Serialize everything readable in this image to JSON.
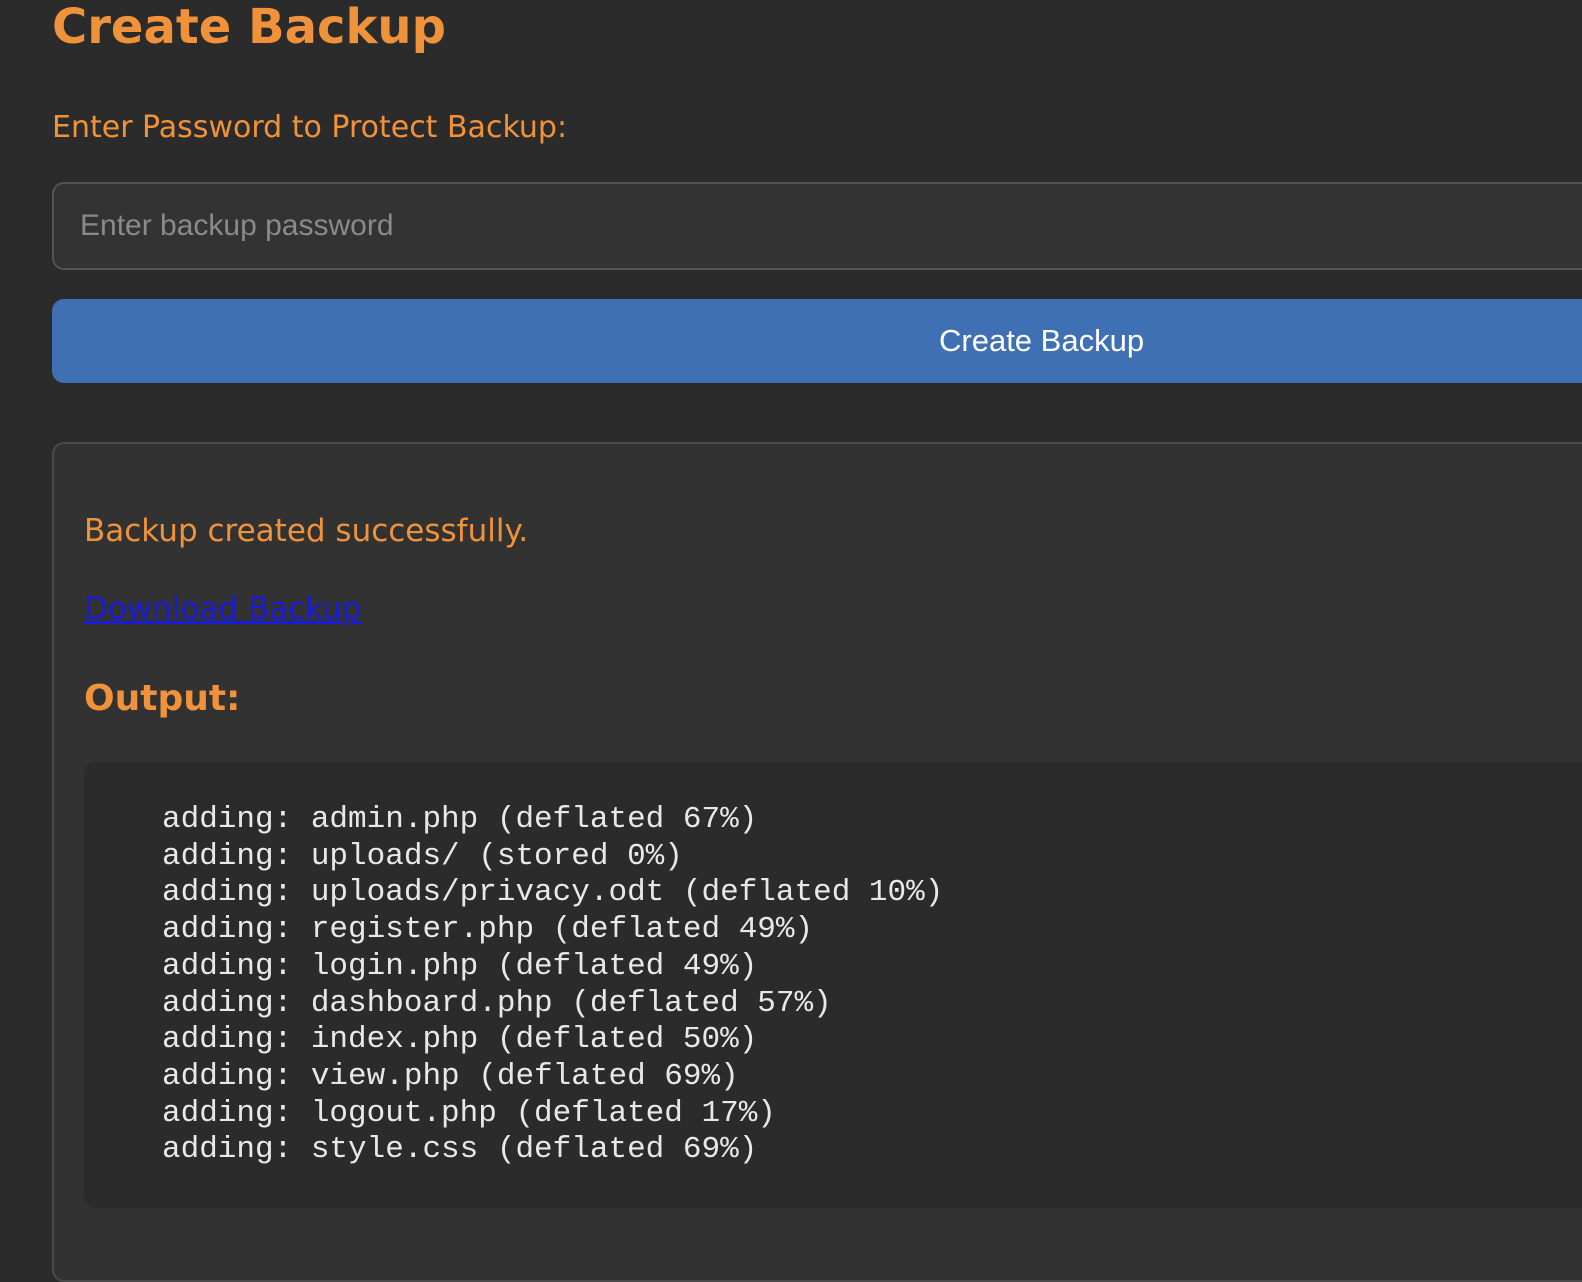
{
  "page": {
    "title": "Create Backup"
  },
  "form": {
    "password_label": "Enter Password to Protect Backup:",
    "password_value": "",
    "password_placeholder": "Enter backup password",
    "submit_label": "Create Backup"
  },
  "result": {
    "message": "Backup created successfully.",
    "download_label": "Download Backup",
    "output_heading": "Output:",
    "output_lines": [
      "adding: admin.php (deflated 67%)",
      "adding: uploads/ (stored 0%)",
      "adding: uploads/privacy.odt (deflated 10%)",
      "adding: register.php (deflated 49%)",
      "adding: login.php (deflated 49%)",
      "adding: dashboard.php (deflated 57%)",
      "adding: index.php (deflated 50%)",
      "adding: view.php (deflated 69%)",
      "adding: logout.php (deflated 17%)",
      "adding: style.css (deflated 69%)"
    ]
  },
  "colors": {
    "background": "#2b2b2b",
    "accent_orange": "#f0923a",
    "button_blue": "#4070b4",
    "link_blue": "#1a1adb",
    "output_text": "#e8e8e8"
  }
}
